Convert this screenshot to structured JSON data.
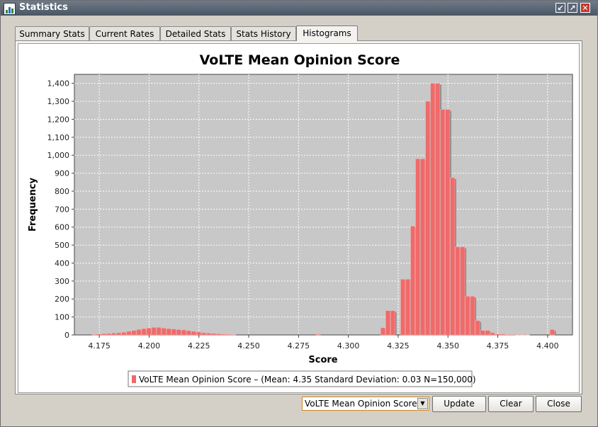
{
  "window": {
    "title": "Statistics"
  },
  "title_buttons": {
    "minimize": "↙",
    "maximize": "↗",
    "close": "✕"
  },
  "tabs": [
    {
      "label": "Summary Stats"
    },
    {
      "label": "Current Rates"
    },
    {
      "label": "Detailed Stats"
    },
    {
      "label": "Stats History"
    },
    {
      "label": "Histograms"
    }
  ],
  "active_tab": "Histograms",
  "controls": {
    "combo_value": "VoLTE Mean Opinion Score",
    "update_label": "Update",
    "clear_label": "Clear",
    "close_label": "Close"
  },
  "colors": {
    "bar": "#f06a6a",
    "plot_bg": "#c8c8c8",
    "accent": "#c8881e"
  },
  "chart_data": {
    "type": "bar",
    "title": "VoLTE Mean Opinion Score",
    "xlabel": "Score",
    "ylabel": "Frequency",
    "xlim": [
      4.1625,
      4.4125
    ],
    "ylim": [
      0,
      1450
    ],
    "xticks": [
      {
        "v": 4.175,
        "label": "4.175"
      },
      {
        "v": 4.2,
        "label": "4.200"
      },
      {
        "v": 4.225,
        "label": "4.225"
      },
      {
        "v": 4.25,
        "label": "4.250"
      },
      {
        "v": 4.275,
        "label": "4.275"
      },
      {
        "v": 4.3,
        "label": "4.300"
      },
      {
        "v": 4.325,
        "label": "4.325"
      },
      {
        "v": 4.35,
        "label": "4.350"
      },
      {
        "v": 4.375,
        "label": "4.375"
      },
      {
        "v": 4.4,
        "label": "4.400"
      }
    ],
    "yticks": [
      {
        "v": 0,
        "label": "0"
      },
      {
        "v": 100,
        "label": "100"
      },
      {
        "v": 200,
        "label": "200"
      },
      {
        "v": 300,
        "label": "300"
      },
      {
        "v": 400,
        "label": "400"
      },
      {
        "v": 500,
        "label": "500"
      },
      {
        "v": 600,
        "label": "600"
      },
      {
        "v": 700,
        "label": "700"
      },
      {
        "v": 800,
        "label": "800"
      },
      {
        "v": 900,
        "label": "900"
      },
      {
        "v": 1000,
        "label": "1,000"
      },
      {
        "v": 1100,
        "label": "1,100"
      },
      {
        "v": 1200,
        "label": "1,200"
      },
      {
        "v": 1300,
        "label": "1,300"
      },
      {
        "v": 1400,
        "label": "1,400"
      }
    ],
    "bin_width": 0.0025,
    "series": [
      {
        "name": "VoLTE Mean Opinion Score – (Mean: 4.35 Standard Deviation: 0.03 N=150,000)",
        "x": [
          4.1725,
          4.175,
          4.1775,
          4.18,
          4.1825,
          4.185,
          4.1875,
          4.19,
          4.1925,
          4.195,
          4.1975,
          4.2,
          4.2025,
          4.205,
          4.2075,
          4.21,
          4.2125,
          4.215,
          4.2175,
          4.22,
          4.2225,
          4.225,
          4.2275,
          4.23,
          4.2325,
          4.235,
          4.2375,
          4.24,
          4.2425,
          4.285,
          4.3175,
          4.32,
          4.3225,
          4.3275,
          4.33,
          4.3325,
          4.335,
          4.3375,
          4.34,
          4.3425,
          4.345,
          4.3475,
          4.35,
          4.3525,
          4.355,
          4.3575,
          4.36,
          4.3625,
          4.365,
          4.3675,
          4.37,
          4.3725,
          4.375,
          4.3775,
          4.38,
          4.3825,
          4.385,
          4.3875,
          4.39,
          4.4025
        ],
        "values": [
          3,
          5,
          7,
          8,
          10,
          12,
          15,
          20,
          25,
          30,
          35,
          38,
          42,
          42,
          38,
          35,
          33,
          30,
          28,
          24,
          20,
          16,
          12,
          10,
          8,
          6,
          4,
          3,
          2,
          4,
          40,
          135,
          135,
          310,
          310,
          605,
          980,
          980,
          1300,
          1400,
          1400,
          1255,
          1255,
          875,
          490,
          490,
          215,
          215,
          80,
          25,
          25,
          12,
          5,
          5,
          2,
          2,
          1,
          1,
          1,
          30
        ]
      }
    ]
  }
}
